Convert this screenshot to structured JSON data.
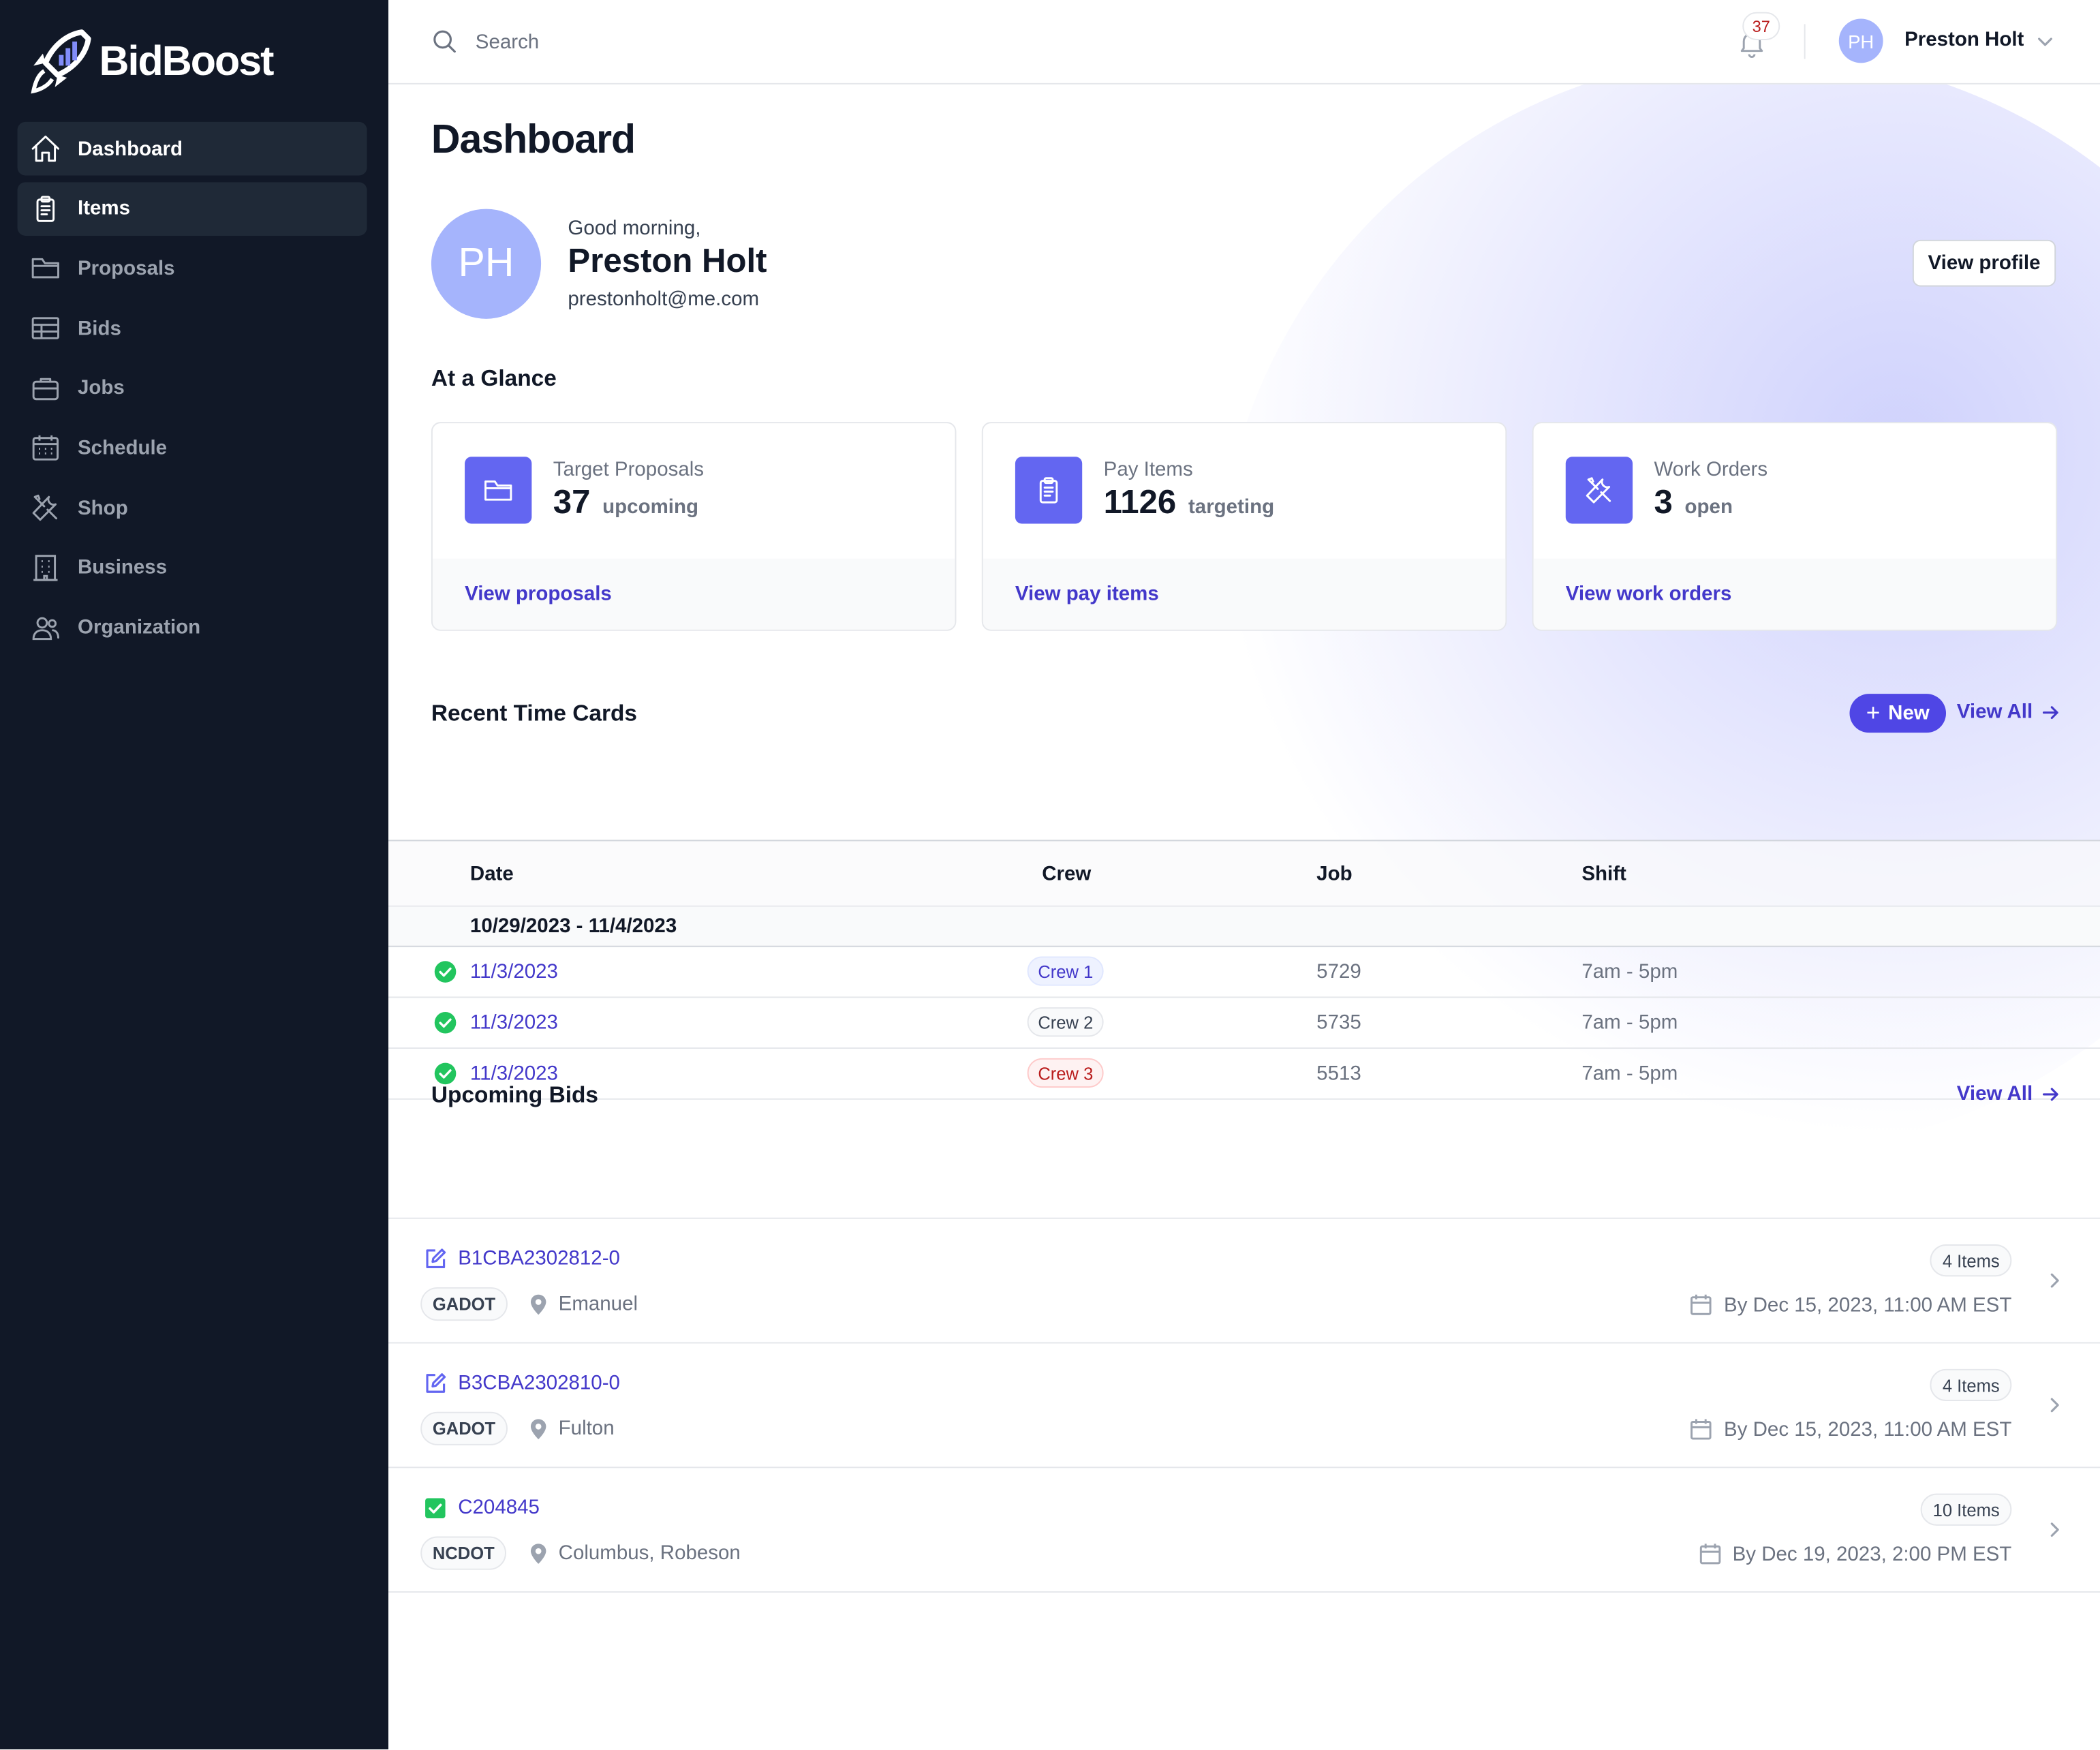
{
  "app": {
    "name": "BidBoost",
    "accent": "#4f46e5",
    "sidebar_bg": "#111827"
  },
  "sidebar": {
    "items": [
      {
        "label": "Dashboard",
        "icon": "home-icon",
        "active": true
      },
      {
        "label": "Items",
        "icon": "clipboard-icon",
        "active": true
      },
      {
        "label": "Proposals",
        "icon": "folder-icon",
        "active": false
      },
      {
        "label": "Bids",
        "icon": "table-icon",
        "active": false
      },
      {
        "label": "Jobs",
        "icon": "briefcase-icon",
        "active": false
      },
      {
        "label": "Schedule",
        "icon": "calendar-icon",
        "active": false
      },
      {
        "label": "Shop",
        "icon": "tools-icon",
        "active": false
      },
      {
        "label": "Business",
        "icon": "building-icon",
        "active": false
      },
      {
        "label": "Organization",
        "icon": "users-icon",
        "active": false
      }
    ]
  },
  "topbar": {
    "search_placeholder": "Search",
    "notification_count": "37",
    "user_initials": "PH",
    "user_name": "Preston Holt"
  },
  "page": {
    "title": "Dashboard"
  },
  "profile": {
    "initials": "PH",
    "greeting": "Good morning,",
    "name": "Preston Holt",
    "email": "prestonholt@me.com",
    "view_profile_label": "View profile"
  },
  "glance": {
    "title": "At a Glance",
    "cards": [
      {
        "label": "Target Proposals",
        "value": "37",
        "unit": "upcoming",
        "link": "View proposals",
        "icon": "folder-icon"
      },
      {
        "label": "Pay Items",
        "value": "1126",
        "unit": "targeting",
        "link": "View pay items",
        "icon": "clipboard-icon"
      },
      {
        "label": "Work Orders",
        "value": "3",
        "unit": "open",
        "link": "View work orders",
        "icon": "tools-icon"
      }
    ]
  },
  "time_cards": {
    "title": "Recent Time Cards",
    "new_label": "New",
    "view_all_label": "View All",
    "columns": [
      "Date",
      "Crew",
      "Job",
      "Shift"
    ],
    "group": "10/29/2023 - 11/4/2023",
    "rows": [
      {
        "date": "11/3/2023",
        "crew": "Crew 1",
        "crew_color": "#4338ca",
        "crew_bg": "#eef2ff",
        "job": "5729",
        "shift": "7am - 5pm"
      },
      {
        "date": "11/3/2023",
        "crew": "Crew 2",
        "crew_color": "#374151",
        "crew_bg": "#f9fafb",
        "job": "5735",
        "shift": "7am - 5pm"
      },
      {
        "date": "11/3/2023",
        "crew": "Crew 3",
        "crew_color": "#b91c1c",
        "crew_bg": "#fef2f2",
        "job": "5513",
        "shift": "7am - 5pm"
      }
    ]
  },
  "upcoming_bids": {
    "title": "Upcoming Bids",
    "view_all_label": "View All",
    "rows": [
      {
        "id": "B1CBA2302812-0",
        "status_icon": "edit-icon",
        "agency": "GADOT",
        "location": "Emanuel",
        "items": "4 Items",
        "due": "By Dec 15, 2023, 11:00 AM EST"
      },
      {
        "id": "B3CBA2302810-0",
        "status_icon": "edit-icon",
        "agency": "GADOT",
        "location": "Fulton",
        "items": "4 Items",
        "due": "By Dec 15, 2023, 11:00 AM EST"
      },
      {
        "id": "C204845",
        "status_icon": "check-square-icon",
        "agency": "NCDOT",
        "location": "Columbus, Robeson",
        "items": "10 Items",
        "due": "By Dec 19, 2023, 2:00 PM EST"
      }
    ]
  }
}
